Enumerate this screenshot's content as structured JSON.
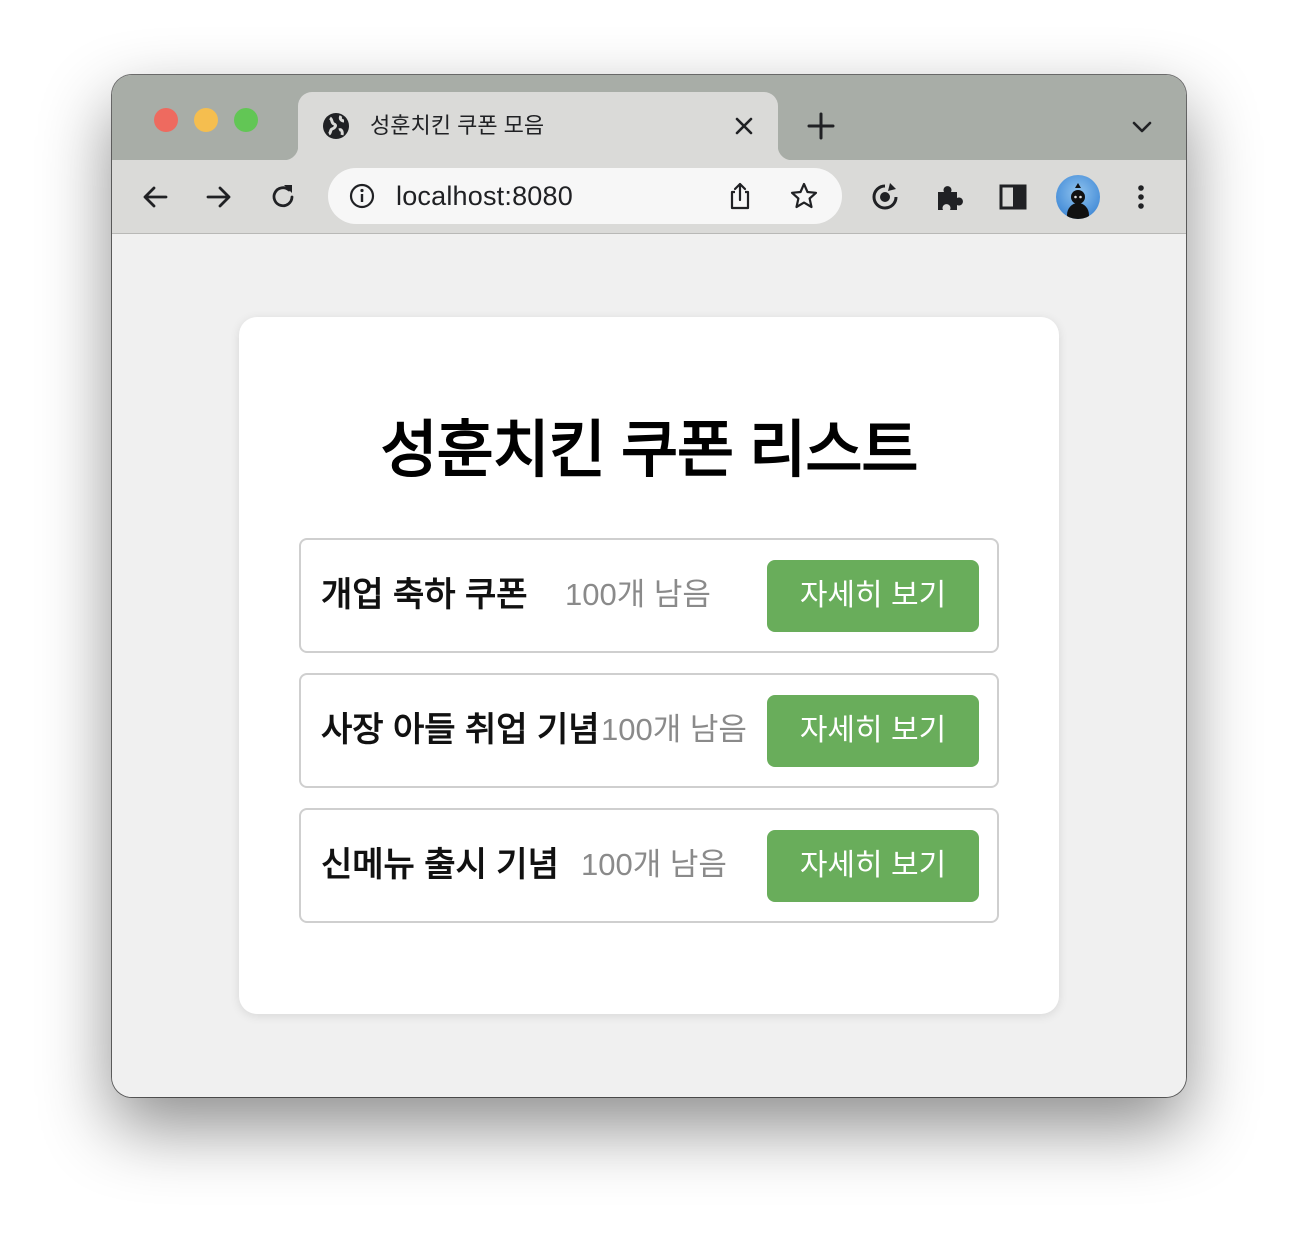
{
  "browser": {
    "tab_title": "성훈치킨 쿠폰 모음",
    "url": "localhost:8080"
  },
  "page": {
    "title": "성훈치킨 쿠폰 리스트",
    "coupons": [
      {
        "name": "개업 축하 쿠폰",
        "remaining": "100개 남음",
        "button": "자세히 보기"
      },
      {
        "name": "사장 아들 취업 기념",
        "remaining": "100개 남음",
        "button": "자세히 보기"
      },
      {
        "name": "신메뉴 출시 기념",
        "remaining": "100개 남음",
        "button": "자세히 보기"
      }
    ]
  },
  "colors": {
    "button_bg": "#69ad5b",
    "remaining_text": "#8a8a8a"
  }
}
